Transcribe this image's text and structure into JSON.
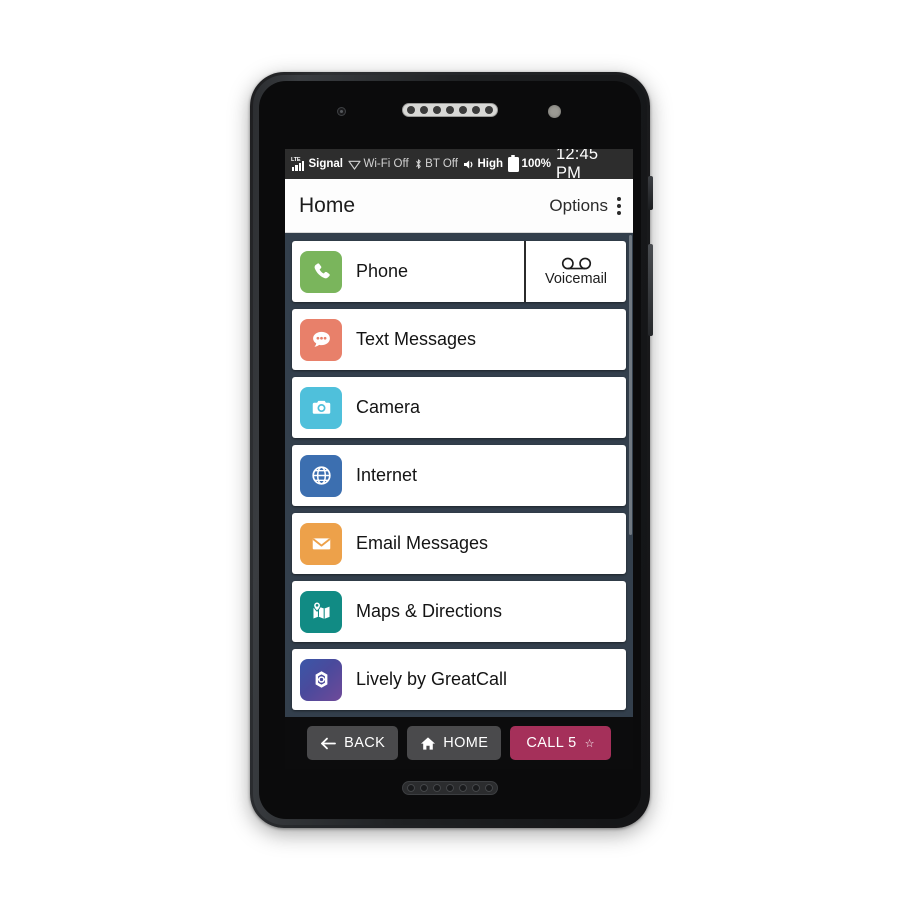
{
  "device": {
    "status_bar": {
      "network_label": "Signal",
      "network_tech": "LTE",
      "wifi": "Wi-Fi Off",
      "bluetooth": "BT Off",
      "volume": "High",
      "battery": "100%",
      "time": "12:45 PM"
    },
    "nav_bar": {
      "back": "BACK",
      "home": "HOME",
      "call_label": "CALL 5",
      "call_star": "☆"
    }
  },
  "app": {
    "title": "Home",
    "options_label": "Options",
    "colors": {
      "screen_bg": "#333f4c",
      "titlebar_bg": "#fdfdfd",
      "call_button": "#a5305a",
      "status_bar": "#2d2d2d"
    },
    "rows": [
      {
        "label": "Phone",
        "icon": "phone-icon",
        "icon_color": "#7ab55c",
        "secondary": {
          "label": "Voicemail",
          "icon": "voicemail-icon"
        }
      },
      {
        "label": "Text Messages",
        "icon": "speech-bubble-icon",
        "icon_color": "#e8806a"
      },
      {
        "label": "Camera",
        "icon": "camera-icon",
        "icon_color": "#4fc0db"
      },
      {
        "label": "Internet",
        "icon": "globe-icon",
        "icon_color": "#3c6fb0"
      },
      {
        "label": "Email Messages",
        "icon": "envelope-icon",
        "icon_color": "#eda14a"
      },
      {
        "label": "Maps & Directions",
        "icon": "map-pin-icon",
        "icon_color": "#118b84"
      },
      {
        "label": "Lively by GreatCall",
        "icon": "lively-emblem-icon",
        "icon_color": "#4a4a9c"
      }
    ]
  }
}
